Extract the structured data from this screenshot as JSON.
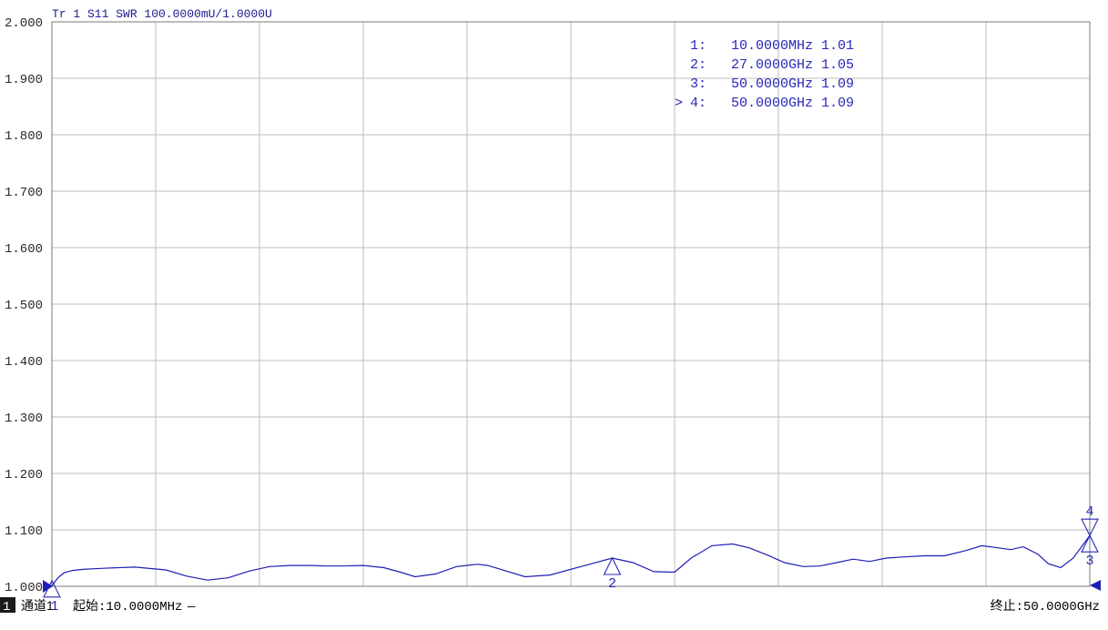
{
  "header": {
    "trace_label": "Tr 1  S11 SWR 100.0000mU/1.0000U"
  },
  "colors": {
    "trace": "#1e1eb4",
    "grid": "#bdbdbd",
    "marker": "#2727b8",
    "frame": "#7a7a7a"
  },
  "footer": {
    "channel_number": "1",
    "channel_label": "通道1",
    "start_label": "起始:10.0000MHz",
    "start_dash": "—",
    "stop_label": "终止:50.0000GHz"
  },
  "marker_table": [
    {
      "active": "",
      "id": "1:",
      "freq": "10.0000MHz",
      "value": "1.01"
    },
    {
      "active": "",
      "id": "2:",
      "freq": "27.0000GHz",
      "value": "1.05"
    },
    {
      "active": "",
      "id": "3:",
      "freq": "50.0000GHz",
      "value": "1.09"
    },
    {
      "active": ">",
      "id": "4:",
      "freq": "50.0000GHz",
      "value": "1.09"
    }
  ],
  "chart_data": {
    "type": "line",
    "title": "",
    "xlabel": "",
    "ylabel": "",
    "x_unit": "GHz",
    "xlim": [
      0.01,
      50
    ],
    "ylim": [
      1.0,
      2.0
    ],
    "grid": true,
    "x_divisions": 10,
    "y_ticks": [
      "2.000",
      "1.900",
      "1.800",
      "1.700",
      "1.600",
      "1.500",
      "1.400",
      "1.300",
      "1.200",
      "1.100",
      "1.000"
    ],
    "series": [
      {
        "x": [
          0.01,
          0.3,
          0.6,
          1.0,
          1.5,
          2.5,
          4.0,
          5.5,
          6.5,
          7.5,
          8.5,
          9.5,
          10.5,
          11.5,
          12.5,
          13.2,
          14.0,
          15.0,
          16.0,
          16.8,
          17.5,
          18.5,
          19.5,
          20.5,
          21.0,
          21.8,
          22.8,
          24.0,
          25.5,
          27.0,
          28.0,
          29.0,
          30.0,
          30.8,
          31.8,
          32.8,
          33.6,
          34.5,
          35.3,
          36.2,
          37.0,
          37.8,
          38.6,
          39.4,
          40.2,
          41.0,
          42.0,
          43.0,
          44.0,
          44.8,
          45.6,
          46.2,
          46.8,
          47.5,
          48.0,
          48.6,
          49.2,
          49.7,
          50.0
        ],
        "y": [
          1.001,
          1.015,
          1.024,
          1.028,
          1.03,
          1.032,
          1.034,
          1.029,
          1.018,
          1.011,
          1.015,
          1.027,
          1.035,
          1.037,
          1.037,
          1.036,
          1.036,
          1.037,
          1.033,
          1.025,
          1.017,
          1.022,
          1.035,
          1.039,
          1.037,
          1.028,
          1.017,
          1.02,
          1.035,
          1.05,
          1.042,
          1.026,
          1.025,
          1.05,
          1.072,
          1.075,
          1.068,
          1.055,
          1.042,
          1.035,
          1.036,
          1.042,
          1.048,
          1.044,
          1.05,
          1.052,
          1.054,
          1.054,
          1.063,
          1.072,
          1.068,
          1.065,
          1.07,
          1.057,
          1.04,
          1.033,
          1.05,
          1.075,
          1.09
        ]
      }
    ],
    "markers": [
      {
        "id": "1",
        "x": 0.01,
        "y": 1.01
      },
      {
        "id": "2",
        "x": 27.0,
        "y": 1.05
      },
      {
        "id": "3",
        "x": 50.0,
        "y": 1.09
      },
      {
        "id": "4",
        "x": 50.0,
        "y": 1.09
      }
    ]
  }
}
